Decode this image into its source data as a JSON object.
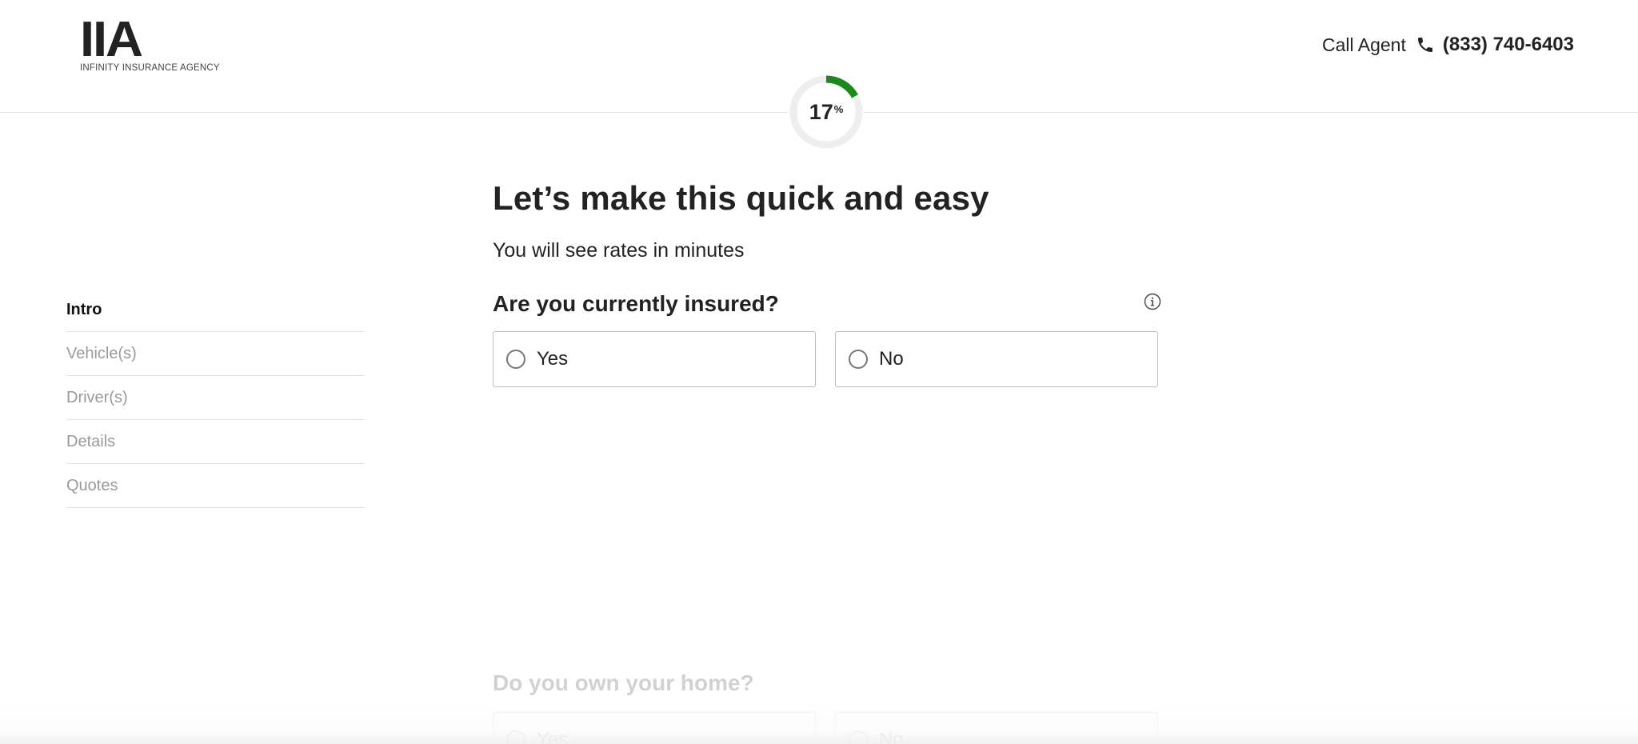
{
  "header": {
    "logo_mark": "IIA",
    "logo_subtitle": "INFINITY INSURANCE AGENCY",
    "call_label": "Call Agent",
    "phone_icon": "phone-icon",
    "phone_number": "(833) 740-6403"
  },
  "progress": {
    "percent": 17,
    "value": "17",
    "unit": "%",
    "ring_color": "#1a8a1a",
    "track_color": "#eeeeee"
  },
  "sidebar": {
    "steps": [
      {
        "label": "Intro",
        "active": true
      },
      {
        "label": "Vehicle(s)",
        "active": false
      },
      {
        "label": "Driver(s)",
        "active": false
      },
      {
        "label": "Details",
        "active": false
      },
      {
        "label": "Quotes",
        "active": false
      }
    ]
  },
  "main": {
    "headline": "Let’s make this quick and easy",
    "subhead": "You will see rates in minutes",
    "question": "Are you currently insured?",
    "info_icon": "info-icon",
    "options": [
      {
        "label": "Yes"
      },
      {
        "label": "No"
      }
    ]
  },
  "next_question": {
    "question": "Do you own your home?",
    "options": [
      {
        "label": "Yes"
      },
      {
        "label": "No"
      }
    ]
  }
}
